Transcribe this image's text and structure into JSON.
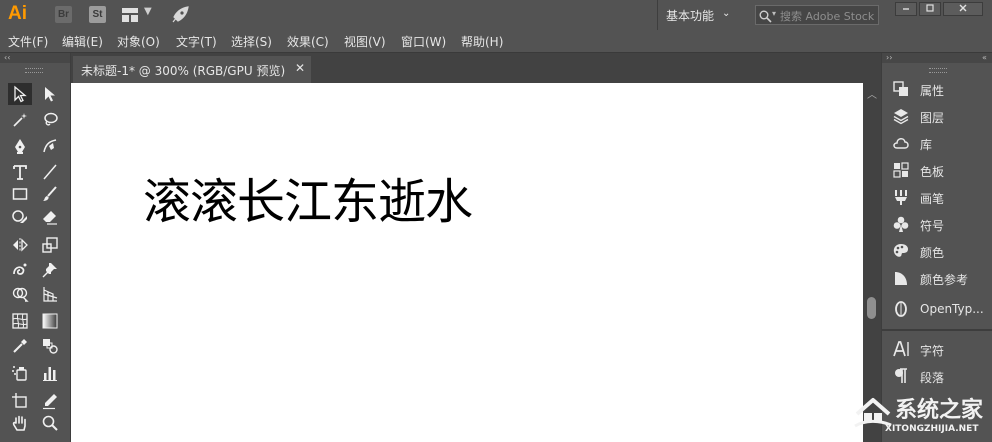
{
  "app": {
    "logo": "Ai",
    "bridge_label": "Br",
    "stock_label": "St",
    "workspace_label": "基本功能",
    "search_placeholder": "搜索 Adobe Stock"
  },
  "menu": [
    "文件(F)",
    "编辑(E)",
    "对象(O)",
    "文字(T)",
    "选择(S)",
    "效果(C)",
    "视图(V)",
    "窗口(W)",
    "帮助(H)"
  ],
  "document": {
    "tab_title": "未标题-1* @ 300% (RGB/GPU 预览)",
    "canvas_text": "滚滚长江东逝水"
  },
  "right_panel": {
    "items": [
      "属性",
      "图层",
      "库",
      "色板",
      "画笔",
      "符号",
      "颜色",
      "颜色参考",
      "OpenTyp...",
      "字符",
      "段落"
    ]
  },
  "tools_panel": {
    "collapse_glyph": "‹‹"
  },
  "watermark": {
    "title": "系统之家",
    "url": "XITONGZHIJIA.NET"
  },
  "colors": {
    "ui_bg": "#535353",
    "logo_orange": "#ff9a00",
    "canvas": "#ffffff"
  }
}
